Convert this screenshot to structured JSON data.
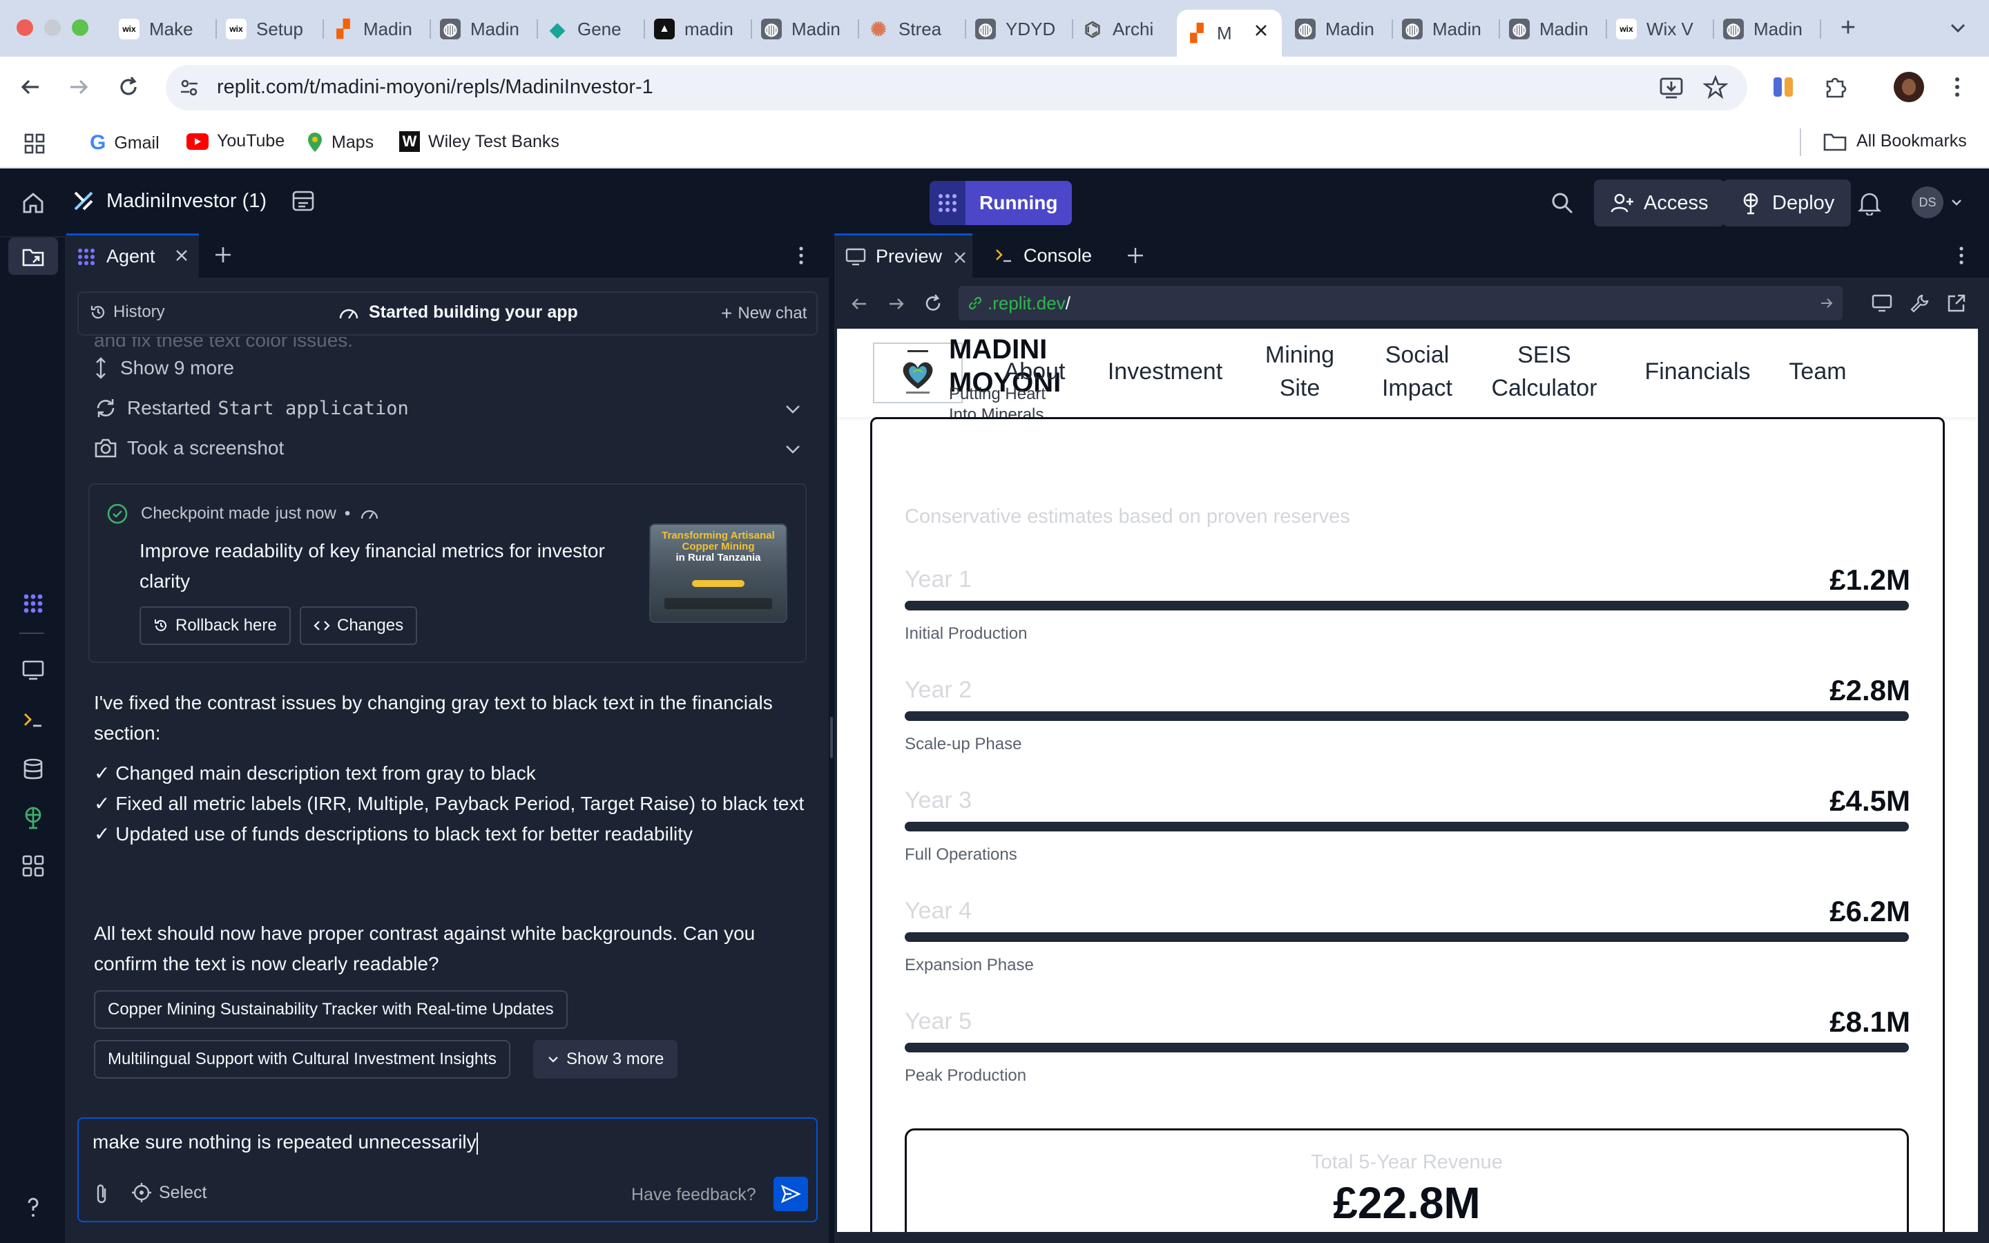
{
  "browser": {
    "tabs": [
      {
        "label": "Make",
        "favicon": "wix"
      },
      {
        "label": "Setup",
        "favicon": "wix"
      },
      {
        "label": "Madin",
        "favicon": "replit"
      },
      {
        "label": "Madin",
        "favicon": "globe"
      },
      {
        "label": "Gene",
        "favicon": "diamond"
      },
      {
        "label": "madin",
        "favicon": "triangle"
      },
      {
        "label": "Madin",
        "favicon": "globe"
      },
      {
        "label": "Strea",
        "favicon": "asterisk"
      },
      {
        "label": "YDYD",
        "favicon": "globe"
      },
      {
        "label": "Archi",
        "favicon": "archi"
      },
      {
        "label": "M",
        "favicon": "replit",
        "active": true
      },
      {
        "label": "Madin",
        "favicon": "globe"
      },
      {
        "label": "Madin",
        "favicon": "globe"
      },
      {
        "label": "Madin",
        "favicon": "globe"
      },
      {
        "label": "Wix V",
        "favicon": "wix"
      },
      {
        "label": "Madin",
        "favicon": "globe"
      }
    ],
    "url": "replit.com/t/madini-moyoni/repls/MadiniInvestor-1",
    "bookmarks": [
      "Gmail",
      "YouTube",
      "Maps",
      "Wiley Test Banks"
    ],
    "all_bookmarks": "All Bookmarks"
  },
  "replit": {
    "project_name": "MadiniInvestor (1)",
    "run_status": "Running",
    "access_label": "Access",
    "deploy_label": "Deploy",
    "avatar_initials": "DS"
  },
  "agent": {
    "tab_label": "Agent",
    "history_label": "History",
    "status_label": "Started building your app",
    "new_chat_label": "New chat",
    "faded_text": "and fix these text color issues.",
    "show_more_label": "Show 9 more",
    "restarted_prefix": "Restarted",
    "restarted_code": "Start application",
    "screenshot_label": "Took a screenshot",
    "checkpoint": {
      "prefix": "Checkpoint made",
      "time": "just now",
      "dot": "•",
      "title": "Improve readability of key financial metrics for investor clarity",
      "rollback_label": "Rollback here",
      "changes_label": "Changes",
      "thumb_title_1": "Transforming Artisanal",
      "thumb_title_2": "Copper Mining",
      "thumb_title_3": "in Rural Tanzania"
    },
    "message_intro": "I've fixed the contrast issues by changing gray text to black text in the financials section:",
    "checklist": [
      "✓ Changed main description text from gray to black",
      "✓ Fixed all metric labels (IRR, Multiple, Payback Period, Target Raise) to black text",
      "✓ Updated use of funds descriptions to black text for better readability"
    ],
    "message_outro": "All text should now have proper contrast against white backgrounds. Can you confirm the text is now clearly readable?",
    "suggestions": [
      "Copper Mining Sustainability Tracker with Real-time Updates",
      "Multilingual Support with Cultural Investment Insights"
    ],
    "show_3_more": "Show 3 more",
    "input_value": "make sure nothing is repeated unnecessarily",
    "select_label": "Select",
    "feedback_label": "Have feedback?"
  },
  "preview": {
    "tab_preview": "Preview",
    "tab_console": "Console",
    "url_domain": ".replit.dev",
    "url_path": "/"
  },
  "site": {
    "brand_line1": "MADINI",
    "brand_line2": "MOYONI",
    "tagline_line1": "Putting Heart",
    "tagline_line2": "Into Minerals",
    "nav": [
      "About",
      "Investment",
      "Mining Site",
      "Social Impact",
      "SEIS Calculator",
      "Financials",
      "Team"
    ],
    "subtitle": "Conservative estimates based on proven reserves",
    "years": [
      {
        "label": "Year 1",
        "value": "£1.2M",
        "phase": "Initial Production"
      },
      {
        "label": "Year 2",
        "value": "£2.8M",
        "phase": "Scale-up Phase"
      },
      {
        "label": "Year 3",
        "value": "£4.5M",
        "phase": "Full Operations"
      },
      {
        "label": "Year 4",
        "value": "£6.2M",
        "phase": "Expansion Phase"
      },
      {
        "label": "Year 5",
        "value": "£8.1M",
        "phase": "Peak Production"
      }
    ],
    "total_label": "Total 5-Year Revenue",
    "total_value": "£22.8M"
  },
  "colors": {
    "run_badge": "#4c47c9",
    "accent_blue": "#0053d6",
    "checkpoint_green": "#3fae6b",
    "url_green": "#30b64e",
    "panel_bg": "#1c2333",
    "app_bg": "#0e1525"
  }
}
